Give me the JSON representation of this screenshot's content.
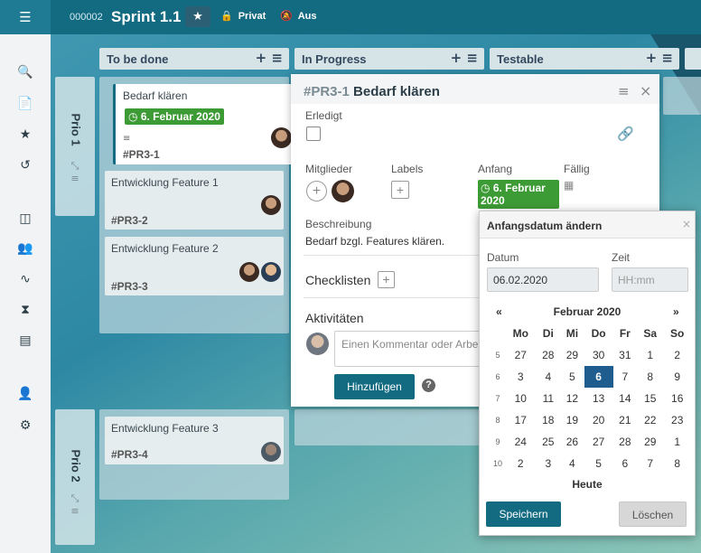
{
  "topbar": {
    "project_id": "000002",
    "project_name": "Sprint 1.1",
    "privacy": "Privat",
    "notify": "Aus"
  },
  "columns": [
    {
      "title": "To be done"
    },
    {
      "title": "In Progress"
    },
    {
      "title": "Testable"
    }
  ],
  "column_ops": "+ ≡",
  "swimlanes": [
    {
      "label": "Prio 1"
    },
    {
      "label": "Prio 2"
    }
  ],
  "cards": [
    {
      "title": "Bedarf klären",
      "date": "6. Februar 2020",
      "id": "#PR3-1"
    },
    {
      "title": "Entwicklung Feature 1",
      "id": "#PR3-2"
    },
    {
      "title": "Entwicklung Feature 2",
      "id": "#PR3-3"
    },
    {
      "title": "Entwicklung Feature 3",
      "id": "#PR3-4"
    }
  ],
  "modal": {
    "id": "#PR3-1",
    "title": "Bedarf klären",
    "done_label": "Erledigt",
    "members_label": "Mitglieder",
    "labels_label": "Labels",
    "start_label": "Anfang",
    "due_label": "Fällig",
    "start_value": "6. Februar 2020",
    "desc_label": "Beschreibung",
    "desc": "Bedarf bzgl. Features klären.",
    "checklists": "Checklisten",
    "activities": "Aktivitäten",
    "comment_placeholder": "Einen Kommentar oder Arbeits",
    "add_button": "Hinzufügen"
  },
  "datepicker": {
    "title": "Anfangsdatum ändern",
    "date_label": "Datum",
    "time_label": "Zeit",
    "date_value": "06.02.2020",
    "time_placeholder": "HH:mm",
    "prev": "«",
    "next": "»",
    "month": "Februar 2020",
    "weekdays": [
      "Mo",
      "Di",
      "Mi",
      "Do",
      "Fr",
      "Sa",
      "So"
    ],
    "weeks": [
      {
        "wk": "5",
        "days": [
          "27",
          "28",
          "29",
          "30",
          "31",
          "1",
          "2"
        ]
      },
      {
        "wk": "6",
        "days": [
          "3",
          "4",
          "5",
          "6",
          "7",
          "8",
          "9"
        ]
      },
      {
        "wk": "7",
        "days": [
          "10",
          "11",
          "12",
          "13",
          "14",
          "15",
          "16"
        ]
      },
      {
        "wk": "8",
        "days": [
          "17",
          "18",
          "19",
          "20",
          "21",
          "22",
          "23"
        ]
      },
      {
        "wk": "9",
        "days": [
          "24",
          "25",
          "26",
          "27",
          "28",
          "29",
          "1"
        ]
      },
      {
        "wk": "10",
        "days": [
          "2",
          "3",
          "4",
          "5",
          "6",
          "7",
          "8"
        ]
      }
    ],
    "selected_day": "6",
    "today": "Heute",
    "save": "Speichern",
    "delete": "Löschen"
  },
  "colors": {
    "accent": "#136b82",
    "green": "#3d9b35",
    "selected": "#1f5d8f"
  }
}
